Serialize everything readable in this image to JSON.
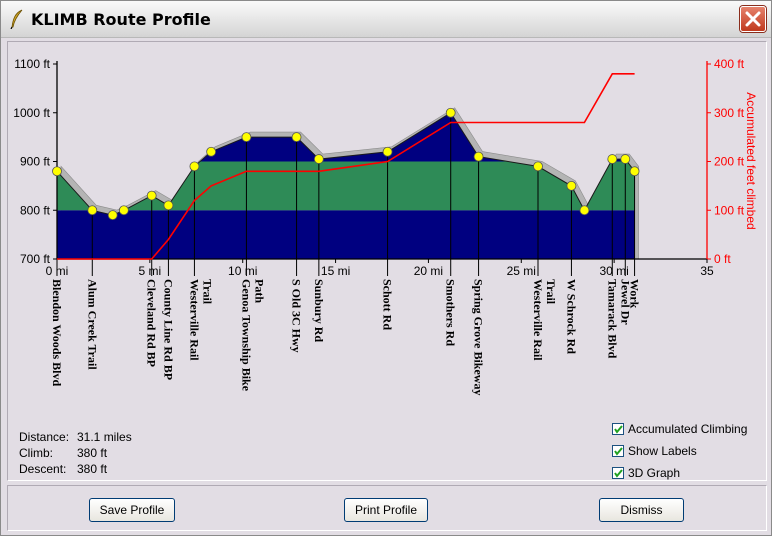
{
  "window": {
    "title": "KLIMB Route Profile",
    "app_icon": "feather-quill-icon",
    "close_icon": "close-icon"
  },
  "chart_data": {
    "type": "area",
    "x": [
      0,
      1.9,
      3.0,
      3.6,
      5.1,
      6.0,
      7.4,
      8.3,
      10.2,
      12.9,
      14.1,
      17.8,
      21.2,
      22.7,
      25.9,
      27.7,
      28.4,
      29.9,
      30.6,
      31.1
    ],
    "elevation_ft": [
      880,
      800,
      790,
      800,
      830,
      810,
      890,
      920,
      950,
      950,
      905,
      920,
      1000,
      910,
      890,
      850,
      800,
      905,
      905,
      880
    ],
    "accumulated_climb_ft": [
      0,
      0,
      0,
      0,
      0,
      40,
      120,
      150,
      180,
      180,
      180,
      200,
      280,
      280,
      280,
      280,
      280,
      380,
      380,
      380
    ],
    "labels": [
      "Blendon Woods Blvd",
      "Alum Creek Trail",
      "",
      "",
      "Cleveland Rd BP",
      "County Line Rd BP",
      "Westerville Rail Trail",
      "",
      "Genoa Township Bike Path",
      "S Old 3C Hwy",
      "Sunbury Rd",
      "Schott Rd",
      "Smothers Rd",
      "Spring Grove Bikeway",
      "Westerville Rail Trail",
      "W Schrock Rd",
      "",
      "Tamarack Blvd",
      "Jewel Dr",
      "Work"
    ],
    "x_axis": {
      "min": 0,
      "max": 35,
      "ticks": [
        0,
        5,
        10,
        15,
        20,
        25,
        30,
        35
      ],
      "tick_labels": [
        "0 mi",
        "5 mi",
        "10 mi",
        "15 mi",
        "20 mi",
        "25 mi",
        "30 mi",
        "35"
      ]
    },
    "y_axis_left": {
      "min": 700,
      "max": 1100,
      "ticks": [
        700,
        800,
        900,
        1000,
        1100
      ],
      "tick_labels": [
        "700 ft",
        "800 ft",
        "900 ft",
        "1000 ft",
        "1100 ft"
      ]
    },
    "y_axis_right": {
      "min": 0,
      "max": 400,
      "ticks": [
        0,
        100,
        200,
        300,
        400
      ],
      "tick_labels": [
        "0 ft",
        "100 ft",
        "200 ft",
        "300 ft",
        "400 ft"
      ],
      "label": "Accumulated feet climbed",
      "color": "#ff0000"
    },
    "band_colors": [
      "#000080",
      "#2e8b57",
      "#000080"
    ],
    "band_breaks_ft": [
      800,
      900
    ],
    "shadow_color": "#b4b4b4",
    "marker_color": "#ffff00",
    "climb_line_color": "#ff0000",
    "three_d": true
  },
  "stats": [
    {
      "label": "Distance:",
      "value": "31.1 miles"
    },
    {
      "label": "Climb:",
      "value": "380 ft"
    },
    {
      "label": "Descent:",
      "value": "380 ft"
    }
  ],
  "options": [
    {
      "label": "Accumulated Climbing",
      "checked": true
    },
    {
      "label": "Show Labels",
      "checked": true
    },
    {
      "label": "3D Graph",
      "checked": true
    }
  ],
  "buttons": {
    "save": "Save Profile",
    "print": "Print Profile",
    "dismiss": "Dismiss"
  }
}
